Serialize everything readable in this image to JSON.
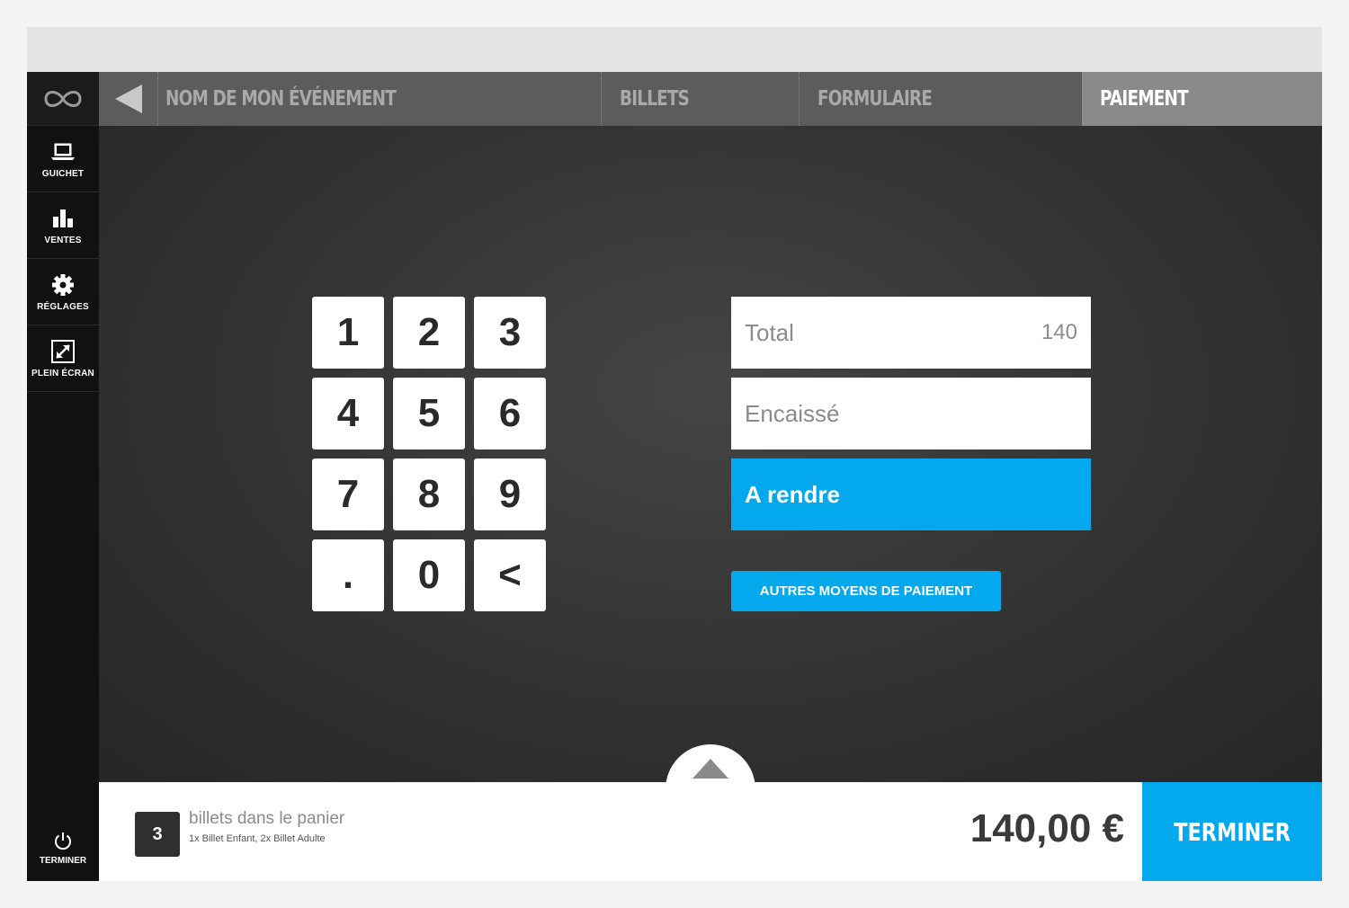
{
  "colors": {
    "accent": "#03a9ec",
    "sidebar": "#111111",
    "nav": "#5c5c5c",
    "nav_active": "#8a8a8a"
  },
  "sidebar": {
    "logo_icon": "infinity-logo-icon",
    "items": [
      {
        "label": "GUICHET",
        "icon": "laptop-icon"
      },
      {
        "label": "VENTES",
        "icon": "bar-chart-icon"
      },
      {
        "label": "RÉGLAGES",
        "icon": "gear-icon"
      },
      {
        "label": "PLEIN ÉCRAN",
        "icon": "fullscreen-icon"
      }
    ],
    "bottom": {
      "label": "TERMINER",
      "icon": "power-icon"
    }
  },
  "nav": {
    "back_icon": "back-arrow-icon",
    "event": "NOM DE MON ÉVÉNEMENT",
    "tabs": [
      "BILLETS",
      "FORMULAIRE",
      "PAIEMENT"
    ],
    "active_tab": "PAIEMENT"
  },
  "keypad": {
    "keys": [
      "1",
      "2",
      "3",
      "4",
      "5",
      "6",
      "7",
      "8",
      "9",
      ".",
      "0",
      "<"
    ]
  },
  "payment": {
    "total_label": "Total",
    "total_value": "140",
    "encaisse_label": "Encaissé",
    "encaisse_value": "",
    "rendre_label": "A rendre",
    "rendre_value": "",
    "other_methods": "AUTRES MOYENS DE PAIEMENT"
  },
  "cart": {
    "count": "3",
    "title": "billets dans le panier",
    "detail": "1x Billet Enfant, 2x Billet Adulte",
    "total": "140,00 €",
    "finish": "TERMINER",
    "toggle_icon": "chevron-up-icon"
  }
}
